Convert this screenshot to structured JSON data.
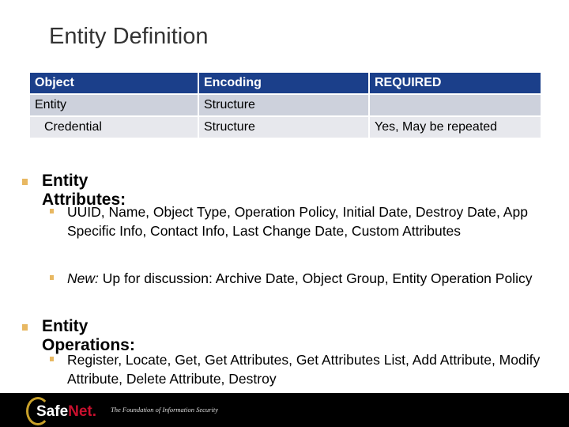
{
  "slide": {
    "title": "Entity Definition"
  },
  "table": {
    "headers": [
      "Object",
      "Encoding",
      "REQUIRED"
    ],
    "rows": [
      [
        "Entity",
        "Structure",
        ""
      ],
      [
        "Credential",
        "Structure",
        "Yes, May be repeated"
      ]
    ]
  },
  "content": {
    "attributes": {
      "heading": "Entity Attributes:",
      "items": [
        "UUID, Name, Object Type, Operation Policy, Initial Date, Destroy Date, App Specific Info, Contact Info, Last Change Date, Custom Attributes"
      ],
      "new_prefix": "New:",
      "new_text": " Up for discussion: Archive Date, Object Group, Entity Operation Policy"
    },
    "operations": {
      "heading": "Entity Operations:",
      "items": [
        "Register, Locate, Get, Get Attributes, Get Attributes List, Add Attribute, Modify Attribute, Delete Attribute, Destroy"
      ]
    }
  },
  "footer": {
    "logo_safe": "Safe",
    "logo_net": "Net",
    "logo_dot": ".",
    "tagline": "The Foundation of Information Security",
    "colors": {
      "background": "#000000",
      "net": "#c8102e",
      "ring": "#c8a02a"
    }
  },
  "colors": {
    "table_header": "#1b3f8a",
    "row_odd": "#cdd1dc",
    "row_even": "#e7e8ed",
    "bullet": "#e8b862"
  }
}
